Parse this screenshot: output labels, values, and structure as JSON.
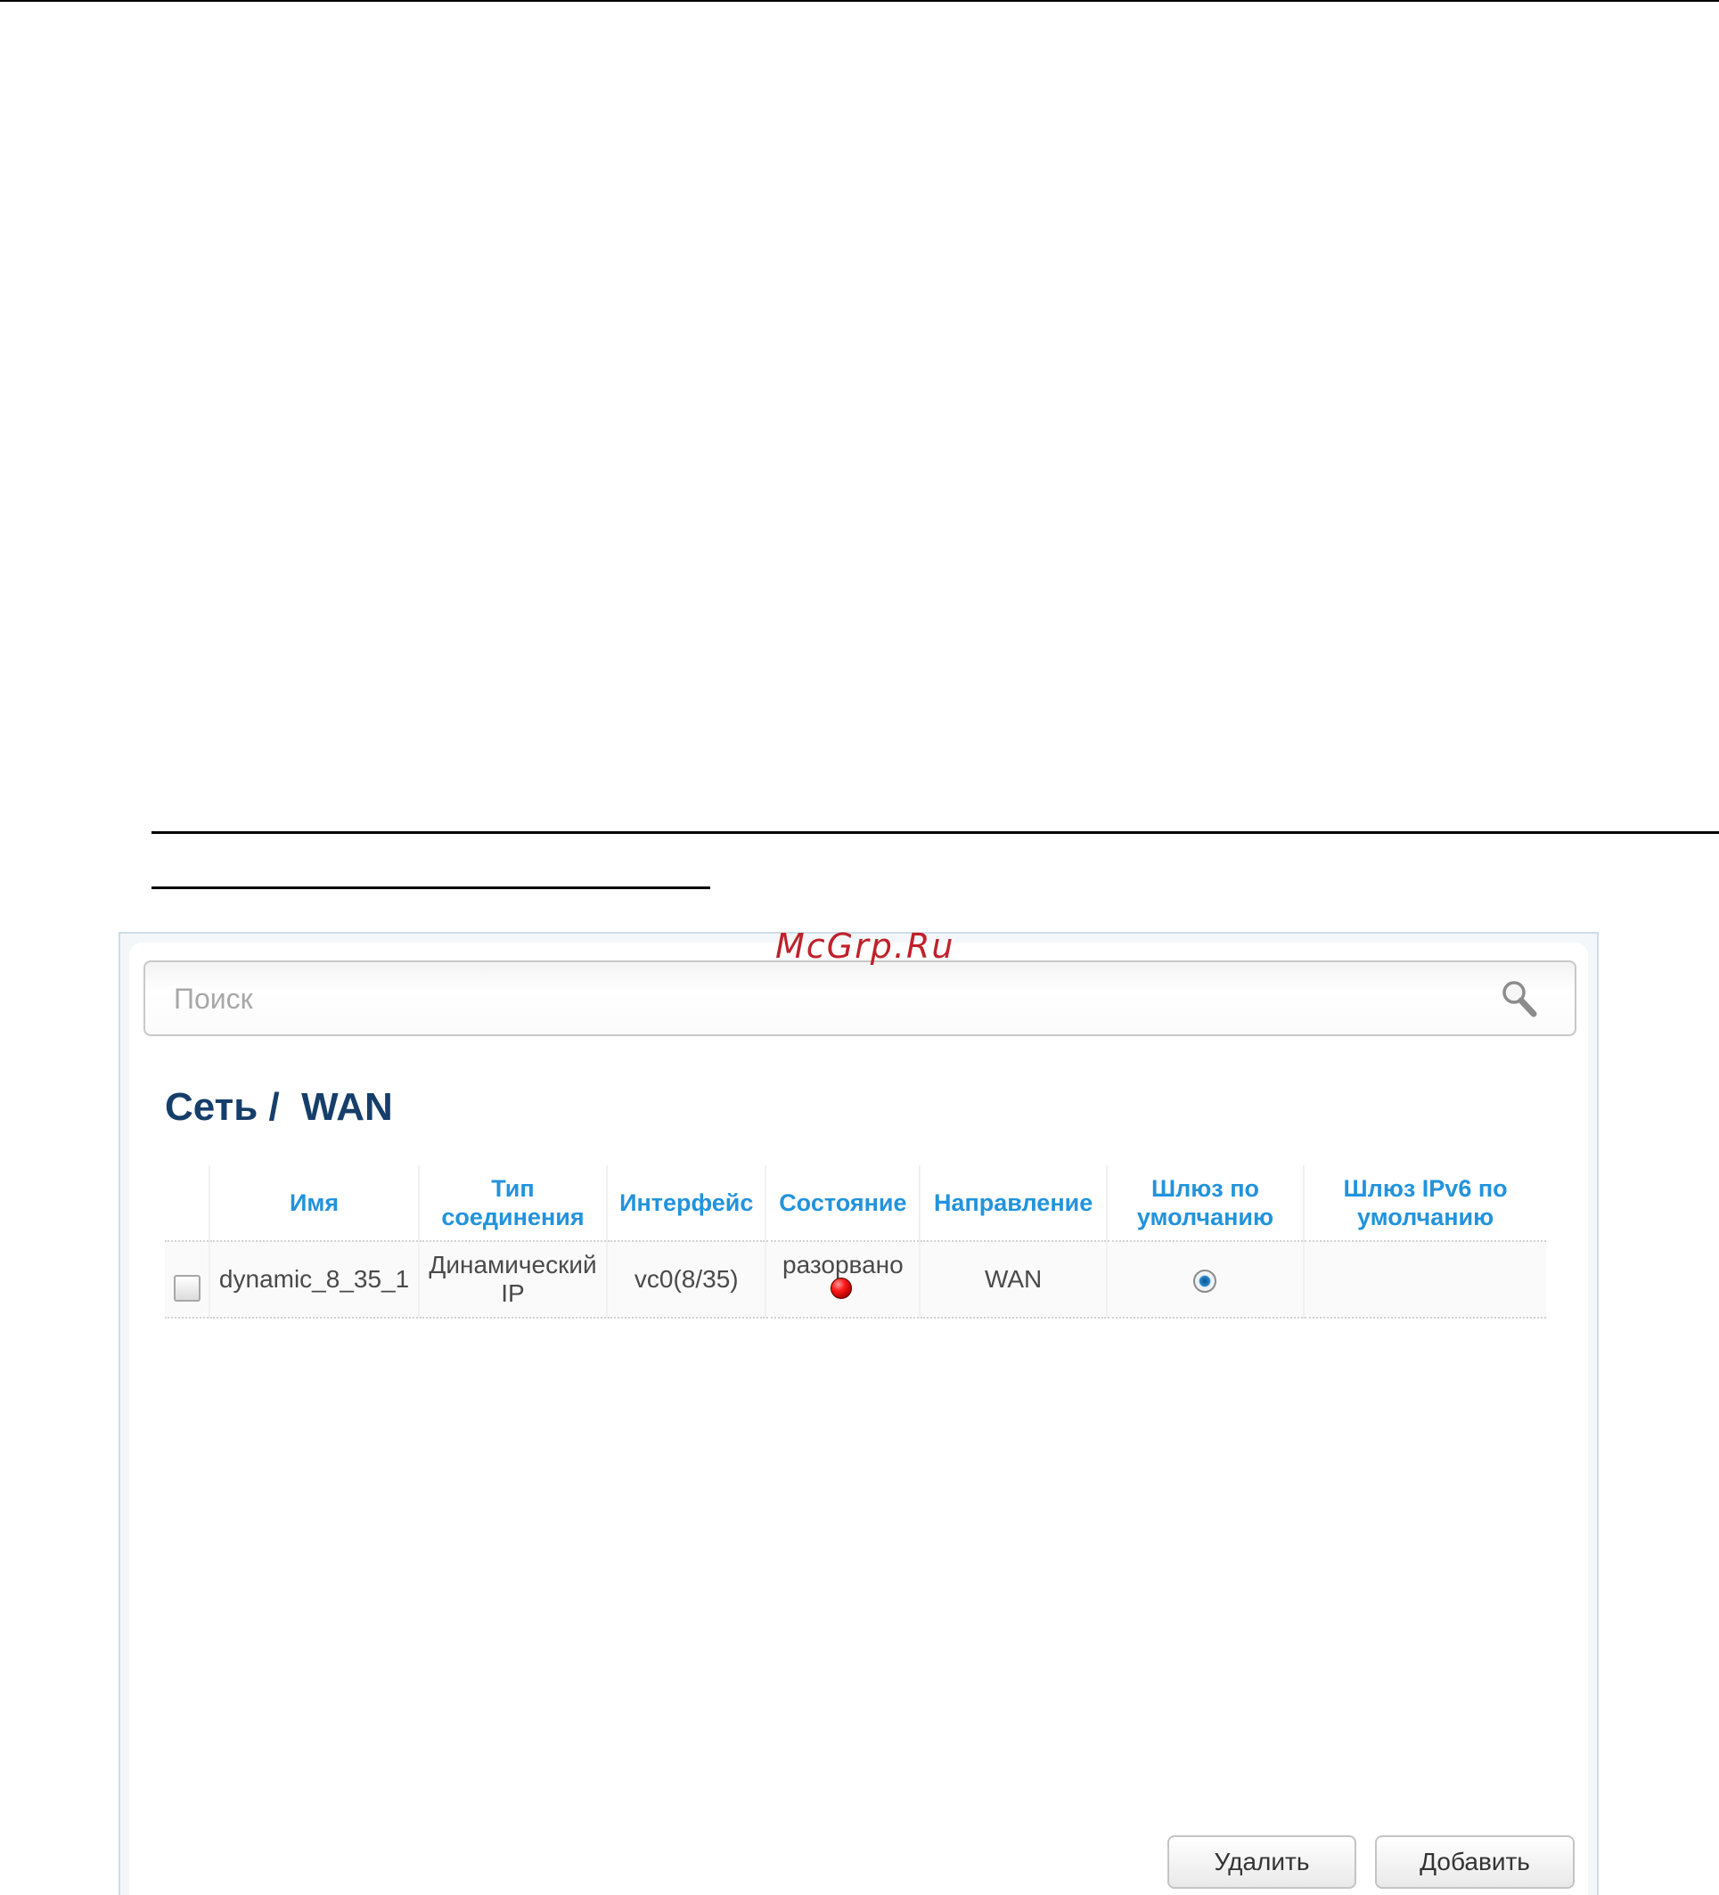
{
  "watermark": "McGrp.Ru",
  "search": {
    "placeholder": "Поиск",
    "icon": "search-icon"
  },
  "page_title": "Сеть /  WAN",
  "table": {
    "headers": {
      "name": "Имя",
      "type_line1": "Тип",
      "type_line2": "соединения",
      "interface": "Интерфейс",
      "state": "Состояние",
      "direction": "Направление",
      "gw_line1": "Шлюз по",
      "gw_line2": "умолчанию",
      "gw6_line1": "Шлюз IPv6 по",
      "gw6_line2": "умолчанию"
    },
    "rows": [
      {
        "checked": false,
        "name": "dynamic_8_35_1",
        "type_line1": "Динамический",
        "type_line2": "IP",
        "interface": "vc0(8/35)",
        "state": "разорвано",
        "state_indicator_color": "#e00000",
        "direction": "WAN",
        "default_gateway": true,
        "default_gateway_ipv6": ""
      }
    ]
  },
  "buttons": {
    "delete": "Удалить",
    "add": "Добавить"
  },
  "colors": {
    "header_text": "#2293dc",
    "title": "#163e6a",
    "watermark": "#c0212b"
  }
}
